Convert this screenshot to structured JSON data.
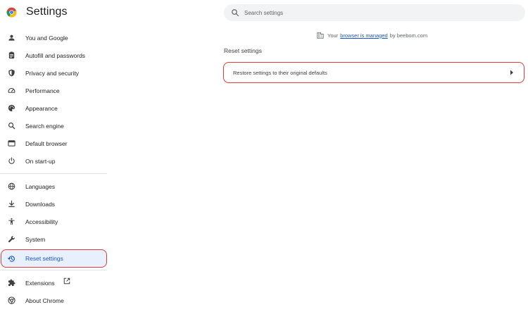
{
  "header": {
    "title": "Settings",
    "logo_icon": "chrome-logo",
    "search_placeholder": "Search settings"
  },
  "sidebar": {
    "items": [
      {
        "label": "You and Google",
        "icon": "person-icon"
      },
      {
        "label": "Autofill and passwords",
        "icon": "clipboard-icon"
      },
      {
        "label": "Privacy and security",
        "icon": "shield-icon"
      },
      {
        "label": "Performance",
        "icon": "speedometer-icon"
      },
      {
        "label": "Appearance",
        "icon": "palette-icon"
      },
      {
        "label": "Search engine",
        "icon": "search-icon"
      },
      {
        "label": "Default browser",
        "icon": "browser-window-icon"
      },
      {
        "label": "On start-up",
        "icon": "power-icon"
      },
      {
        "label": "Languages",
        "icon": "globe-icon"
      },
      {
        "label": "Downloads",
        "icon": "download-icon"
      },
      {
        "label": "Accessibility",
        "icon": "accessibility-icon"
      },
      {
        "label": "System",
        "icon": "wrench-icon"
      },
      {
        "label": "Reset settings",
        "icon": "history-icon",
        "active": true
      },
      {
        "label": "Extensions",
        "icon": "puzzle-icon"
      },
      {
        "label": "About Chrome",
        "icon": "chrome-icon"
      }
    ]
  },
  "managed": {
    "prefix": "Your",
    "link": "browser is managed",
    "suffix": "by beebom.com"
  },
  "main": {
    "section_title": "Reset settings",
    "restore_label": "Restore settings to their original defaults"
  },
  "colors": {
    "accent": "#1a56c4",
    "active_bg": "#e8f0fe",
    "highlight_border": "#e53935"
  }
}
